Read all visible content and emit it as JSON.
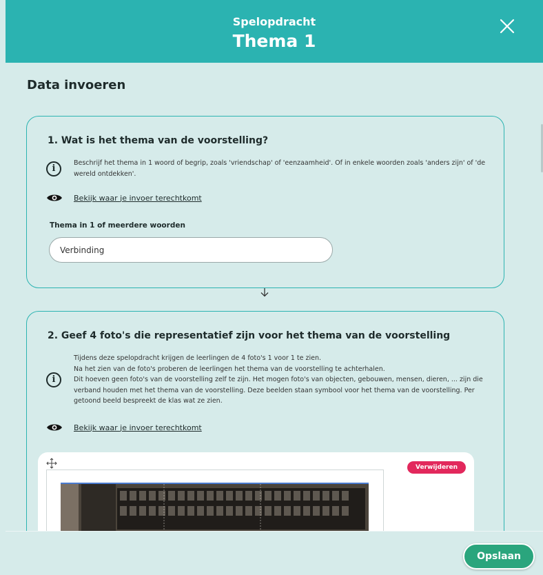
{
  "header": {
    "subtitle": "Spelopdracht",
    "title": "Thema 1",
    "close_icon": "close-icon"
  },
  "section": {
    "title": "Data invoeren"
  },
  "question1": {
    "title": "1. Wat is het thema van de voorstelling?",
    "info": "Beschrijf het thema in 1 woord of begrip, zoals 'vriendschap' of 'eenzaamheid'. Of in enkele woorden zoals 'anders zijn' of 'de wereld ontdekken'.",
    "link": "Bekijk waar je invoer terechtkomt",
    "field_label": "Thema in 1 of meerdere woorden",
    "field_value": "Verbinding"
  },
  "question2": {
    "title": "2. Geef 4 foto's die representatief zijn voor het thema van de voorstelling",
    "info_lines": [
      "Tijdens deze spelopdracht krijgen de leerlingen de 4 foto's 1 voor 1 te zien.",
      "Na het zien van de foto's proberen de leerlingen het thema van de voorstelling te achterhalen.",
      "Dit hoeven geen foto's van de voorstelling zelf te zijn. Het mogen foto's van objecten, gebouwen, mensen, dieren, ... zijn die verband houden met het thema van de voorstelling. Deze beelden staan symbool voor het thema van de voorstelling. Per getoond beeld bespreekt de klas wat ze zien."
    ],
    "link": "Bekijk waar je invoer terechtkomt",
    "remove_label": "Verwijderen"
  },
  "footer": {
    "save_label": "Opslaan"
  },
  "colors": {
    "teal": "#2bb3b1",
    "background": "#d6ebea",
    "remove": "#e2285c",
    "save": "#2aa57d"
  }
}
